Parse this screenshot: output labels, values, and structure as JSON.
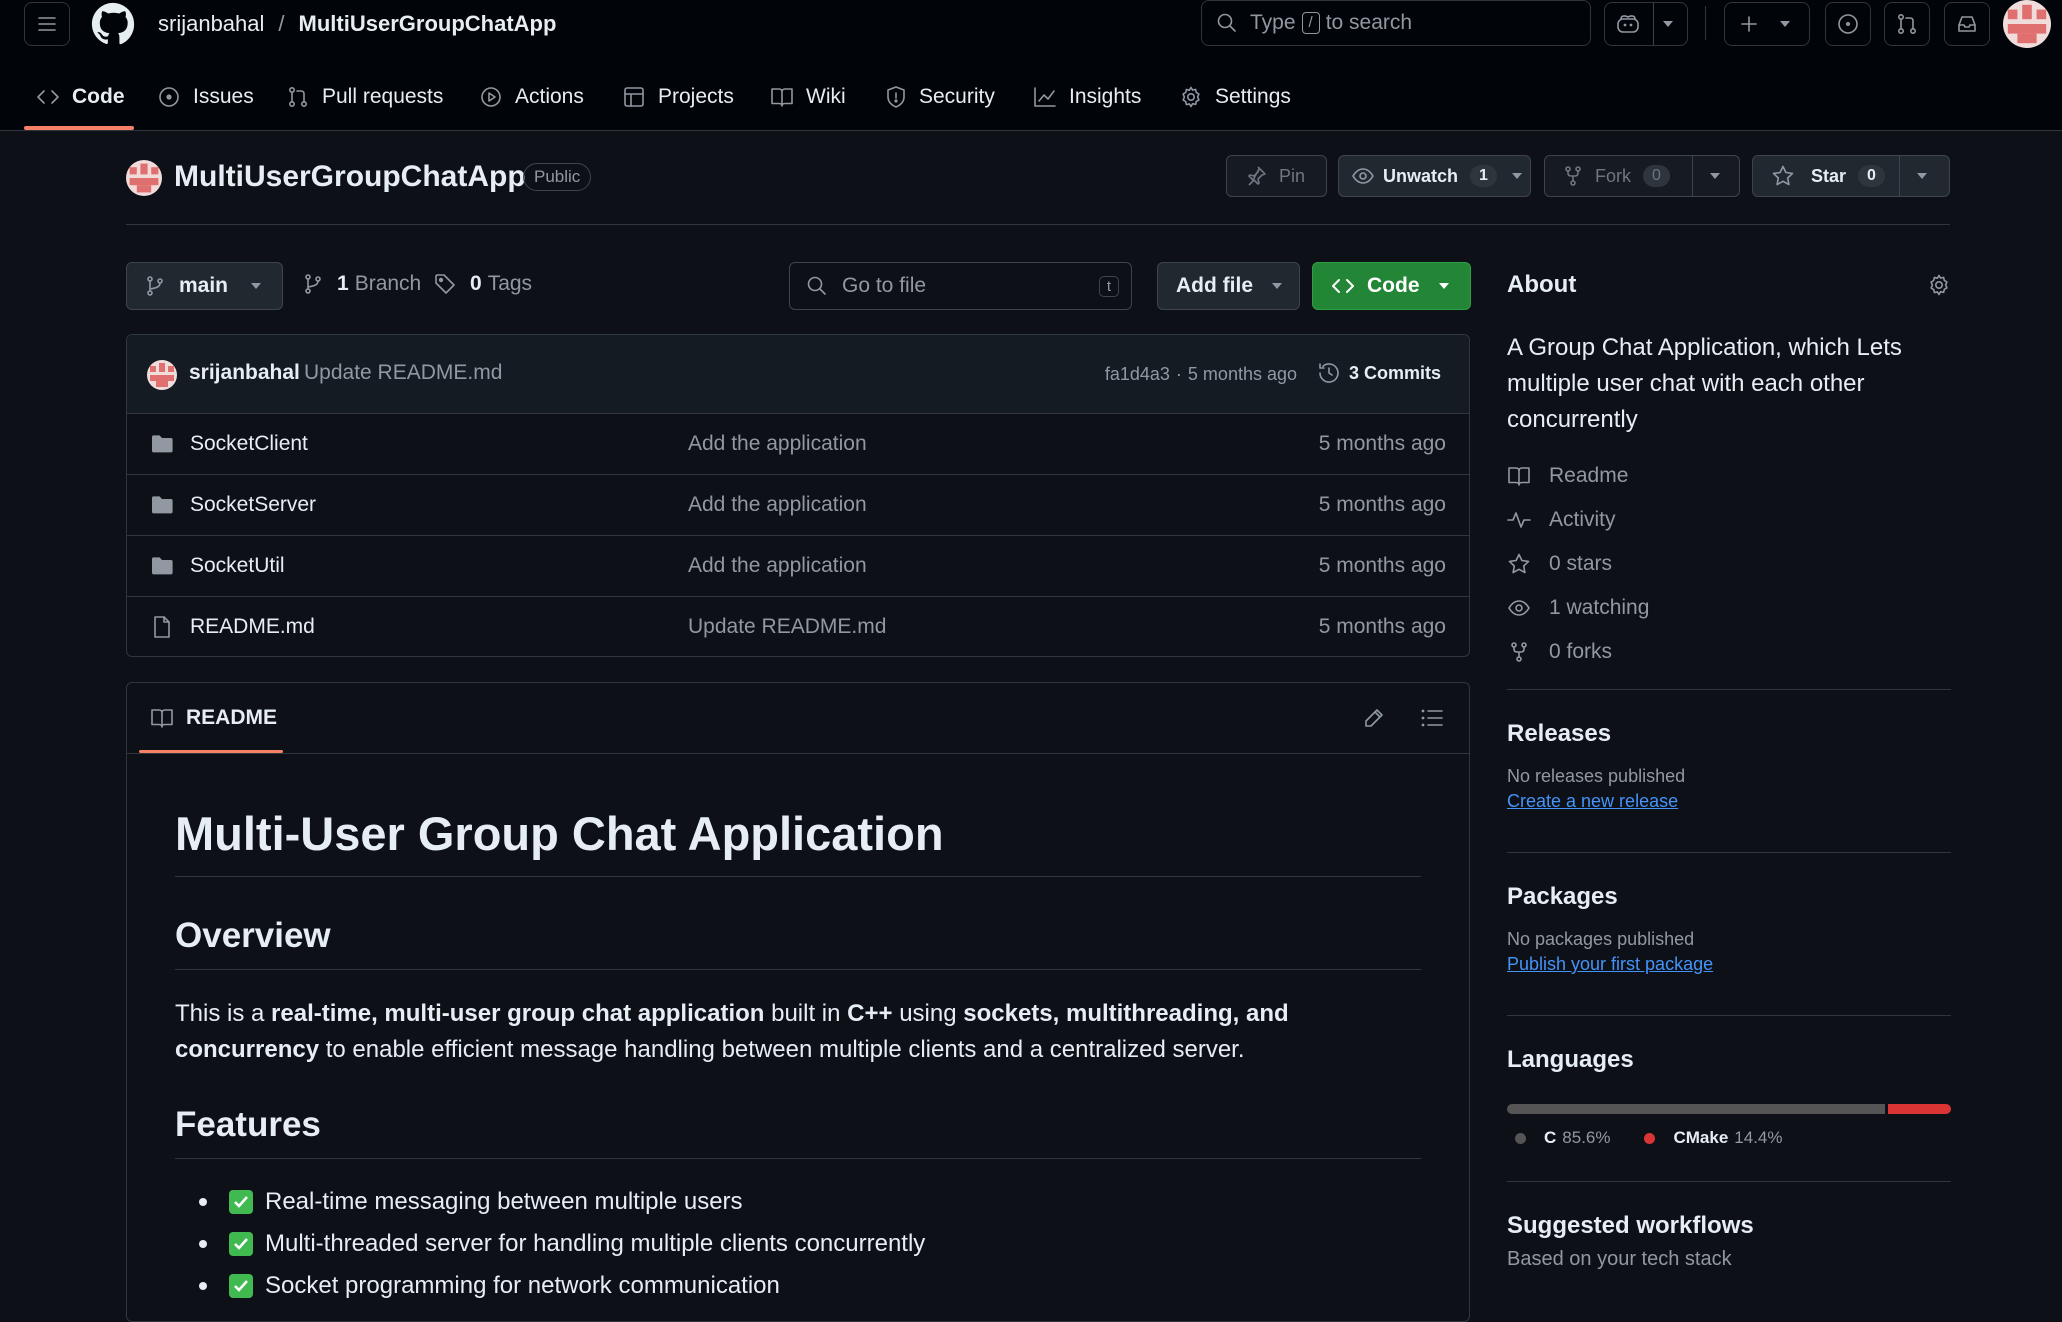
{
  "header": {
    "owner": "srijanbahal",
    "slash": "/",
    "repo": "MultiUserGroupChatApp",
    "search_prefix": "Type",
    "search_key": "/",
    "search_suffix": "to search"
  },
  "tabs": [
    {
      "label": "Code",
      "icon": "code-icon"
    },
    {
      "label": "Issues",
      "icon": "issue-icon"
    },
    {
      "label": "Pull requests",
      "icon": "pull-request-icon"
    },
    {
      "label": "Actions",
      "icon": "play-icon"
    },
    {
      "label": "Projects",
      "icon": "table-icon"
    },
    {
      "label": "Wiki",
      "icon": "book-icon"
    },
    {
      "label": "Security",
      "icon": "shield-icon"
    },
    {
      "label": "Insights",
      "icon": "graph-icon"
    },
    {
      "label": "Settings",
      "icon": "gear-icon"
    }
  ],
  "repo": {
    "title": "MultiUserGroupChatApp",
    "visibility": "Public",
    "pin": "Pin",
    "unwatch": "Unwatch",
    "watch_count": "1",
    "fork": "Fork",
    "fork_count": "0",
    "star": "Star",
    "star_count": "0"
  },
  "toolbar": {
    "branch": "main",
    "branch_count": "1",
    "branch_label": "Branch",
    "tag_count": "0",
    "tag_label": "Tags",
    "goto_placeholder": "Go to file",
    "goto_key": "t",
    "add_file": "Add file",
    "code": "Code"
  },
  "commit": {
    "author": "srijanbahal",
    "message": "Update README.md",
    "hash": "fa1d4a3",
    "sep": "·",
    "time": "5 months ago",
    "count": "3 Commits"
  },
  "files": [
    {
      "name": "SocketClient",
      "type": "folder",
      "message": "Add the application",
      "date": "5 months ago"
    },
    {
      "name": "SocketServer",
      "type": "folder",
      "message": "Add the application",
      "date": "5 months ago"
    },
    {
      "name": "SocketUtil",
      "type": "folder",
      "message": "Add the application",
      "date": "5 months ago"
    },
    {
      "name": "README.md",
      "type": "file",
      "message": "Update README.md",
      "date": "5 months ago"
    }
  ],
  "readme": {
    "tab": "README",
    "h1": "Multi-User Group Chat Application",
    "overview_h": "Overview",
    "p": {
      "t1": "This is a ",
      "b1": "real-time, multi-user group chat application",
      "t2": " built in ",
      "b2": "C++",
      "t3": " using ",
      "b3": "sockets, multithreading, and concurrency",
      "t4": " to enable efficient message handling between multiple clients and a centralized server."
    },
    "features_h": "Features",
    "features": [
      "Real-time messaging between multiple users",
      "Multi-threaded server for handling multiple clients concurrently",
      "Socket programming for network communication"
    ]
  },
  "about": {
    "title": "About",
    "description": "A Group Chat Application, which Lets multiple user chat with each other concurrently",
    "readme": "Readme",
    "activity": "Activity",
    "stars": "0 stars",
    "watching": "1 watching",
    "forks": "0 forks"
  },
  "releases": {
    "title": "Releases",
    "none": "No releases published",
    "link": "Create a new release"
  },
  "packages": {
    "title": "Packages",
    "none": "No packages published",
    "link": "Publish your first package"
  },
  "languages": {
    "title": "Languages",
    "items": [
      {
        "name": "C",
        "percent": "85.6%",
        "value": 85.6,
        "color": "#555555"
      },
      {
        "name": "CMake",
        "percent": "14.4%",
        "value": 14.4,
        "color": "#DA3434"
      }
    ]
  },
  "workflows": {
    "title": "Suggested workflows",
    "subtitle": "Based on your tech stack"
  }
}
